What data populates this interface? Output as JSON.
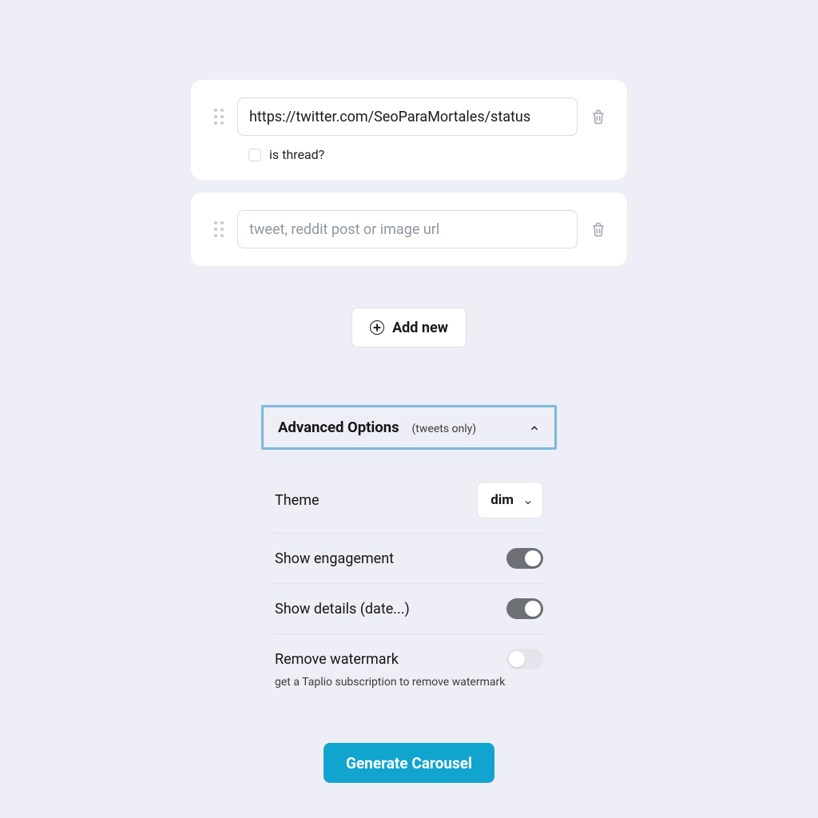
{
  "inputs": [
    {
      "value": "https://twitter.com/SeoParaMortales/status",
      "placeholder": "tweet, reddit post or image url",
      "is_thread_label": "is thread?",
      "is_thread_checked": false,
      "show_thread_checkbox": true
    },
    {
      "value": "",
      "placeholder": "tweet, reddit post or image url",
      "show_thread_checkbox": false
    }
  ],
  "add_new_label": "Add new",
  "accordion": {
    "title": "Advanced Options",
    "note": "(tweets only)",
    "expanded": true
  },
  "theme": {
    "label": "Theme",
    "value": "dim"
  },
  "engagement": {
    "label": "Show engagement",
    "value": true
  },
  "details": {
    "label": "Show details (date...)",
    "value": true
  },
  "watermark": {
    "label": "Remove watermark",
    "value": false,
    "note": "get a Taplio subscription to remove watermark"
  },
  "generate_label": "Generate Carousel"
}
